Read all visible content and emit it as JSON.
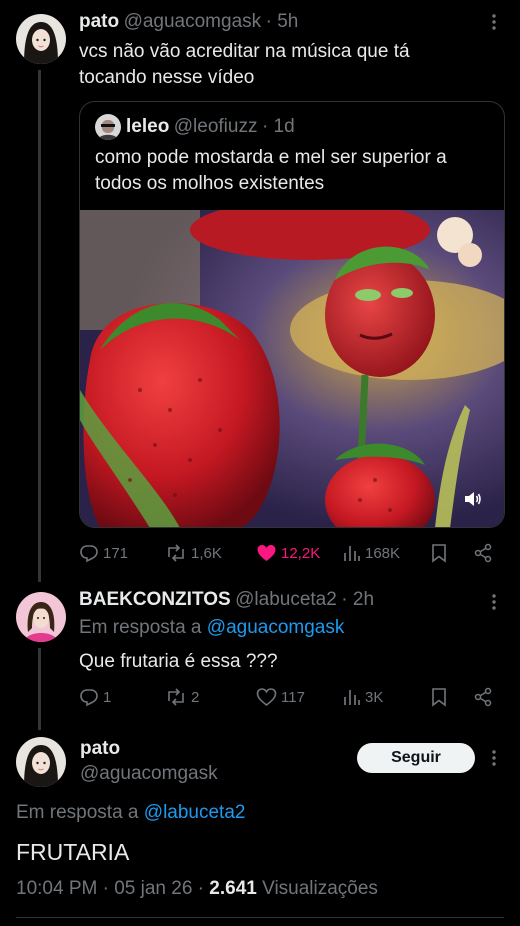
{
  "post1": {
    "name": "pato",
    "handle": "@aguacomgask",
    "time": "· 5h",
    "text_line1": "vcs não vão acreditar na música que tá",
    "text_line2": "tocando nesse vídeo",
    "quote": {
      "name": "leleo",
      "handle": "@leofiuzz",
      "time": "· 1d",
      "text_line1": "como pode mostarda e mel ser superior a",
      "text_line2": "todos os molhos existentes"
    },
    "actions": {
      "replies": "171",
      "reposts": "1,6K",
      "likes": "12,2K",
      "views": "168K"
    }
  },
  "post2": {
    "name": "BAEKCONZITOS",
    "handle": "@labuceta2",
    "time": "· 2h",
    "reply_prefix": "Em resposta a",
    "reply_to": "@aguacomgask",
    "text": "Que frutaria é essa ???",
    "actions": {
      "replies": "1",
      "reposts": "2",
      "likes": "117",
      "views": "3K"
    }
  },
  "main_post": {
    "name": "pato",
    "handle": "@aguacomgask",
    "follow_label": "Seguir",
    "reply_prefix": "Em resposta a",
    "reply_to": "@labuceta2",
    "text": "FRUTARIA",
    "timestamp": "10:04 PM · 05 jan 26 ·",
    "views_count": "2.641",
    "views_label": "Visualizações"
  },
  "colors": {
    "background": "#000000",
    "text": "#e7e9ea",
    "muted": "#71767b",
    "link": "#1d9bf0",
    "like": "#f91880",
    "border": "#2f3336"
  }
}
